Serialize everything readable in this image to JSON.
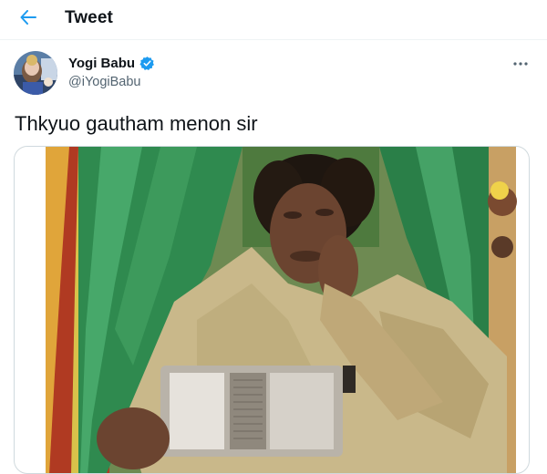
{
  "header": {
    "title": "Tweet",
    "back_icon": "arrow-left-icon",
    "accent_color": "#1d9bf0"
  },
  "author": {
    "display_name": "Yogi Babu",
    "handle": "@iYogiBabu",
    "verified": true,
    "verified_icon": "verified-badge-icon",
    "more_icon": "more-horizontal-icon"
  },
  "tweet": {
    "text": "Thkyuo gautham menon sir"
  },
  "media": {
    "type": "photo",
    "subject": "man-with-radio"
  }
}
